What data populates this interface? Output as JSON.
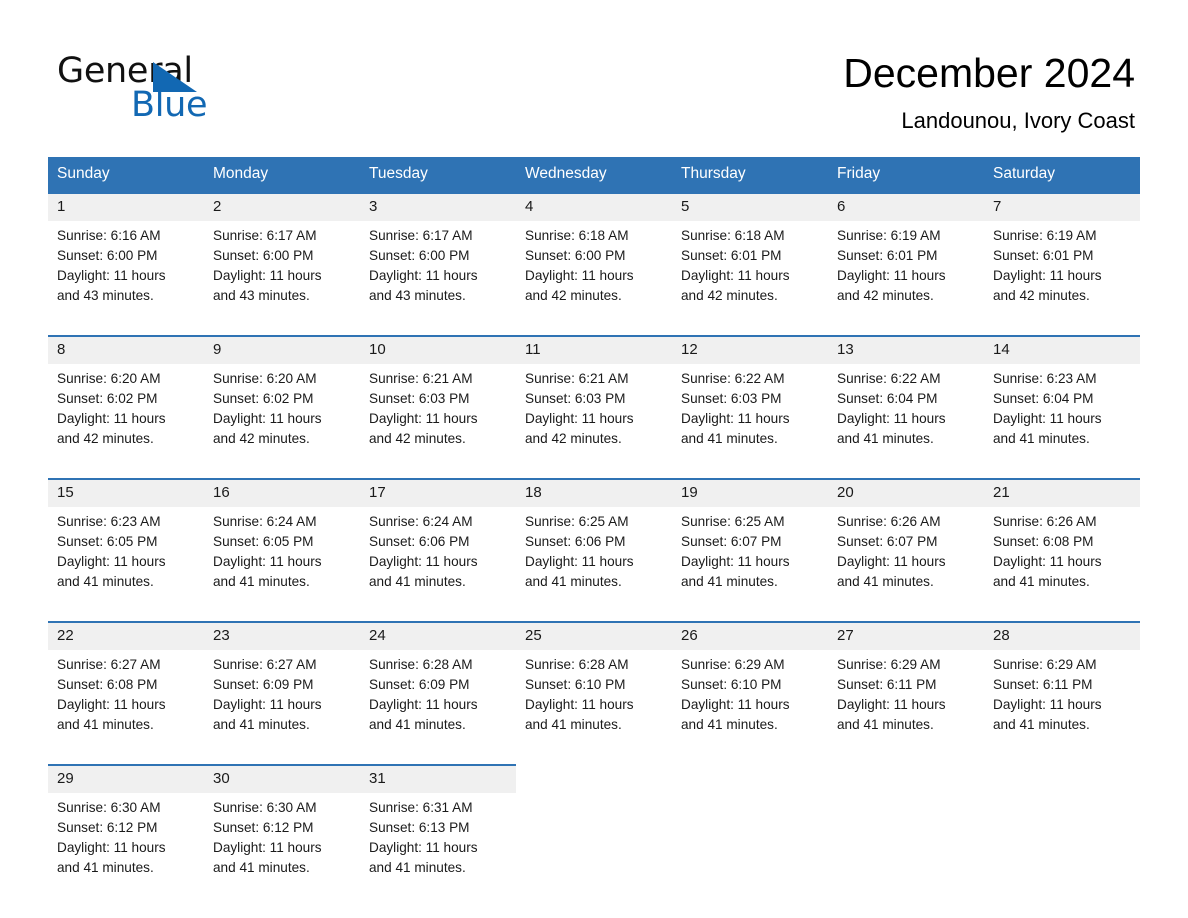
{
  "brand": {
    "name_part1": "General",
    "name_part2": "Blue",
    "flag_icon": "triangle-flag-icon",
    "accent_color": "#1268b3"
  },
  "header": {
    "title": "December 2024",
    "location": "Landounou, Ivory Coast"
  },
  "calendar": {
    "header_bg": "#2f73b4",
    "daynum_bg": "#f0f0f0",
    "weekdays": [
      "Sunday",
      "Monday",
      "Tuesday",
      "Wednesday",
      "Thursday",
      "Friday",
      "Saturday"
    ],
    "weeks": [
      {
        "days": [
          {
            "date": "1",
            "sunrise": "Sunrise: 6:16 AM",
            "sunset": "Sunset: 6:00 PM",
            "daylight_line1": "Daylight: 11 hours",
            "daylight_line2": "and 43 minutes."
          },
          {
            "date": "2",
            "sunrise": "Sunrise: 6:17 AM",
            "sunset": "Sunset: 6:00 PM",
            "daylight_line1": "Daylight: 11 hours",
            "daylight_line2": "and 43 minutes."
          },
          {
            "date": "3",
            "sunrise": "Sunrise: 6:17 AM",
            "sunset": "Sunset: 6:00 PM",
            "daylight_line1": "Daylight: 11 hours",
            "daylight_line2": "and 43 minutes."
          },
          {
            "date": "4",
            "sunrise": "Sunrise: 6:18 AM",
            "sunset": "Sunset: 6:00 PM",
            "daylight_line1": "Daylight: 11 hours",
            "daylight_line2": "and 42 minutes."
          },
          {
            "date": "5",
            "sunrise": "Sunrise: 6:18 AM",
            "sunset": "Sunset: 6:01 PM",
            "daylight_line1": "Daylight: 11 hours",
            "daylight_line2": "and 42 minutes."
          },
          {
            "date": "6",
            "sunrise": "Sunrise: 6:19 AM",
            "sunset": "Sunset: 6:01 PM",
            "daylight_line1": "Daylight: 11 hours",
            "daylight_line2": "and 42 minutes."
          },
          {
            "date": "7",
            "sunrise": "Sunrise: 6:19 AM",
            "sunset": "Sunset: 6:01 PM",
            "daylight_line1": "Daylight: 11 hours",
            "daylight_line2": "and 42 minutes."
          }
        ]
      },
      {
        "days": [
          {
            "date": "8",
            "sunrise": "Sunrise: 6:20 AM",
            "sunset": "Sunset: 6:02 PM",
            "daylight_line1": "Daylight: 11 hours",
            "daylight_line2": "and 42 minutes."
          },
          {
            "date": "9",
            "sunrise": "Sunrise: 6:20 AM",
            "sunset": "Sunset: 6:02 PM",
            "daylight_line1": "Daylight: 11 hours",
            "daylight_line2": "and 42 minutes."
          },
          {
            "date": "10",
            "sunrise": "Sunrise: 6:21 AM",
            "sunset": "Sunset: 6:03 PM",
            "daylight_line1": "Daylight: 11 hours",
            "daylight_line2": "and 42 minutes."
          },
          {
            "date": "11",
            "sunrise": "Sunrise: 6:21 AM",
            "sunset": "Sunset: 6:03 PM",
            "daylight_line1": "Daylight: 11 hours",
            "daylight_line2": "and 42 minutes."
          },
          {
            "date": "12",
            "sunrise": "Sunrise: 6:22 AM",
            "sunset": "Sunset: 6:03 PM",
            "daylight_line1": "Daylight: 11 hours",
            "daylight_line2": "and 41 minutes."
          },
          {
            "date": "13",
            "sunrise": "Sunrise: 6:22 AM",
            "sunset": "Sunset: 6:04 PM",
            "daylight_line1": "Daylight: 11 hours",
            "daylight_line2": "and 41 minutes."
          },
          {
            "date": "14",
            "sunrise": "Sunrise: 6:23 AM",
            "sunset": "Sunset: 6:04 PM",
            "daylight_line1": "Daylight: 11 hours",
            "daylight_line2": "and 41 minutes."
          }
        ]
      },
      {
        "days": [
          {
            "date": "15",
            "sunrise": "Sunrise: 6:23 AM",
            "sunset": "Sunset: 6:05 PM",
            "daylight_line1": "Daylight: 11 hours",
            "daylight_line2": "and 41 minutes."
          },
          {
            "date": "16",
            "sunrise": "Sunrise: 6:24 AM",
            "sunset": "Sunset: 6:05 PM",
            "daylight_line1": "Daylight: 11 hours",
            "daylight_line2": "and 41 minutes."
          },
          {
            "date": "17",
            "sunrise": "Sunrise: 6:24 AM",
            "sunset": "Sunset: 6:06 PM",
            "daylight_line1": "Daylight: 11 hours",
            "daylight_line2": "and 41 minutes."
          },
          {
            "date": "18",
            "sunrise": "Sunrise: 6:25 AM",
            "sunset": "Sunset: 6:06 PM",
            "daylight_line1": "Daylight: 11 hours",
            "daylight_line2": "and 41 minutes."
          },
          {
            "date": "19",
            "sunrise": "Sunrise: 6:25 AM",
            "sunset": "Sunset: 6:07 PM",
            "daylight_line1": "Daylight: 11 hours",
            "daylight_line2": "and 41 minutes."
          },
          {
            "date": "20",
            "sunrise": "Sunrise: 6:26 AM",
            "sunset": "Sunset: 6:07 PM",
            "daylight_line1": "Daylight: 11 hours",
            "daylight_line2": "and 41 minutes."
          },
          {
            "date": "21",
            "sunrise": "Sunrise: 6:26 AM",
            "sunset": "Sunset: 6:08 PM",
            "daylight_line1": "Daylight: 11 hours",
            "daylight_line2": "and 41 minutes."
          }
        ]
      },
      {
        "days": [
          {
            "date": "22",
            "sunrise": "Sunrise: 6:27 AM",
            "sunset": "Sunset: 6:08 PM",
            "daylight_line1": "Daylight: 11 hours",
            "daylight_line2": "and 41 minutes."
          },
          {
            "date": "23",
            "sunrise": "Sunrise: 6:27 AM",
            "sunset": "Sunset: 6:09 PM",
            "daylight_line1": "Daylight: 11 hours",
            "daylight_line2": "and 41 minutes."
          },
          {
            "date": "24",
            "sunrise": "Sunrise: 6:28 AM",
            "sunset": "Sunset: 6:09 PM",
            "daylight_line1": "Daylight: 11 hours",
            "daylight_line2": "and 41 minutes."
          },
          {
            "date": "25",
            "sunrise": "Sunrise: 6:28 AM",
            "sunset": "Sunset: 6:10 PM",
            "daylight_line1": "Daylight: 11 hours",
            "daylight_line2": "and 41 minutes."
          },
          {
            "date": "26",
            "sunrise": "Sunrise: 6:29 AM",
            "sunset": "Sunset: 6:10 PM",
            "daylight_line1": "Daylight: 11 hours",
            "daylight_line2": "and 41 minutes."
          },
          {
            "date": "27",
            "sunrise": "Sunrise: 6:29 AM",
            "sunset": "Sunset: 6:11 PM",
            "daylight_line1": "Daylight: 11 hours",
            "daylight_line2": "and 41 minutes."
          },
          {
            "date": "28",
            "sunrise": "Sunrise: 6:29 AM",
            "sunset": "Sunset: 6:11 PM",
            "daylight_line1": "Daylight: 11 hours",
            "daylight_line2": "and 41 minutes."
          }
        ]
      },
      {
        "days": [
          {
            "date": "29",
            "sunrise": "Sunrise: 6:30 AM",
            "sunset": "Sunset: 6:12 PM",
            "daylight_line1": "Daylight: 11 hours",
            "daylight_line2": "and 41 minutes."
          },
          {
            "date": "30",
            "sunrise": "Sunrise: 6:30 AM",
            "sunset": "Sunset: 6:12 PM",
            "daylight_line1": "Daylight: 11 hours",
            "daylight_line2": "and 41 minutes."
          },
          {
            "date": "31",
            "sunrise": "Sunrise: 6:31 AM",
            "sunset": "Sunset: 6:13 PM",
            "daylight_line1": "Daylight: 11 hours",
            "daylight_line2": "and 41 minutes."
          },
          {
            "date": "",
            "sunrise": "",
            "sunset": "",
            "daylight_line1": "",
            "daylight_line2": ""
          },
          {
            "date": "",
            "sunrise": "",
            "sunset": "",
            "daylight_line1": "",
            "daylight_line2": ""
          },
          {
            "date": "",
            "sunrise": "",
            "sunset": "",
            "daylight_line1": "",
            "daylight_line2": ""
          },
          {
            "date": "",
            "sunrise": "",
            "sunset": "",
            "daylight_line1": "",
            "daylight_line2": ""
          }
        ]
      }
    ]
  }
}
